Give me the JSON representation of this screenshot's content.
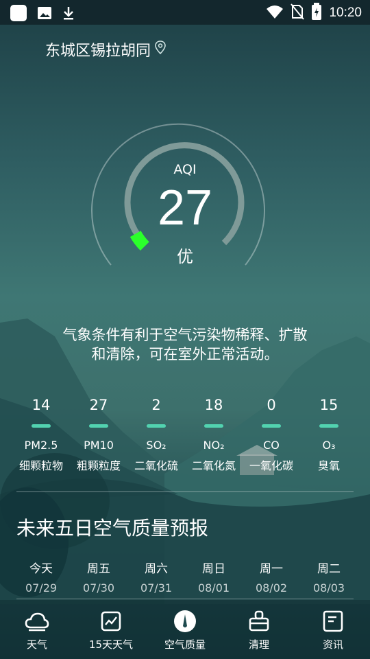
{
  "status_bar": {
    "time": "10:20",
    "icons": [
      "app-icon",
      "image-icon",
      "download-icon",
      "wifi-icon",
      "no-sim-icon",
      "battery-icon"
    ]
  },
  "location": {
    "name": "东城区锡拉胡同",
    "icon": "location-pin-icon"
  },
  "aqi": {
    "label": "AQI",
    "value": "27",
    "level": "优",
    "progress": 0.058,
    "level_color": "#2bff2b"
  },
  "advice": {
    "line1": "气象条件有利于空气污染物稀释、扩散",
    "line2": "和清除，可在室外正常活动。"
  },
  "pollutants": [
    {
      "value": "14",
      "name": "PM2.5",
      "cn": "细颗粒物"
    },
    {
      "value": "27",
      "name": "PM10",
      "cn": "粗颗粒度"
    },
    {
      "value": "2",
      "name": "SO₂",
      "cn": "二氧化硫"
    },
    {
      "value": "18",
      "name": "NO₂",
      "cn": "二氧化氮"
    },
    {
      "value": "0",
      "name": "CO",
      "cn": "一氧化碳"
    },
    {
      "value": "15",
      "name": "O₃",
      "cn": "臭氧"
    }
  ],
  "pollutant_bar_color": "#52d3b0",
  "forecast": {
    "title": "未来五日空气质量预报",
    "days": [
      {
        "day": "今天",
        "date": "07/29"
      },
      {
        "day": "周五",
        "date": "07/30"
      },
      {
        "day": "周六",
        "date": "07/31"
      },
      {
        "day": "周日",
        "date": "08/01"
      },
      {
        "day": "周一",
        "date": "08/02"
      },
      {
        "day": "周二",
        "date": "08/03"
      }
    ]
  },
  "nav": [
    {
      "label": "天气",
      "icon": "cloud-icon"
    },
    {
      "label": "15天天气",
      "icon": "trend-chart-icon"
    },
    {
      "label": "空气质量",
      "icon": "air-quality-icon",
      "active": true
    },
    {
      "label": "清理",
      "icon": "broom-icon"
    },
    {
      "label": "资讯",
      "icon": "news-icon"
    }
  ]
}
